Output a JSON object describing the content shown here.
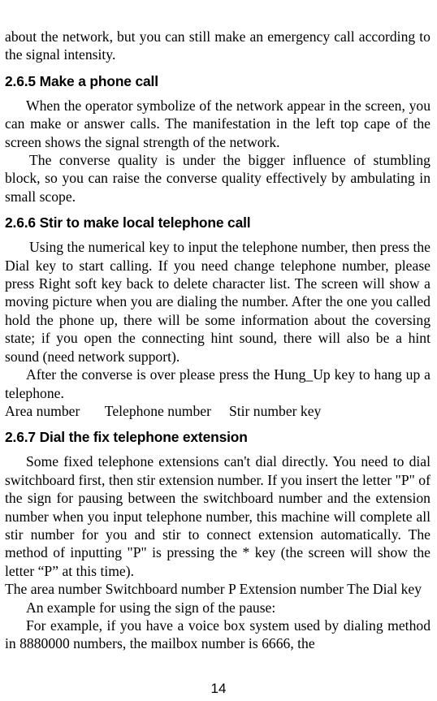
{
  "document": {
    "page_number": "14",
    "blocks": [
      {
        "type": "paragraph",
        "name": "paragraph-network-emergency-call",
        "text": "about the network, but you can still make an emergency call according to the signal intensity."
      },
      {
        "type": "heading",
        "name": "heading-2-6-5",
        "text": "2.6.5 Make a phone call"
      },
      {
        "type": "paragraph",
        "name": "paragraph-operator-symbolize",
        "text": "When the operator symbolize of the network appear in the screen, you can make or answer calls. The manifestation in the left top cape of the screen shows the signal strength of the network."
      },
      {
        "type": "paragraph",
        "name": "paragraph-converse-quality",
        "text": "The converse quality is under the bigger influence of stumbling block, so you can raise the converse quality effectively by ambulating in small scope."
      },
      {
        "type": "heading",
        "name": "heading-2-6-6",
        "text": "2.6.6 Stir to make local telephone call"
      },
      {
        "type": "paragraph",
        "name": "paragraph-using-numerical-key",
        "text": "Using the numerical key to input the telephone number, then press the Dial key to start calling. If you need change telephone number, please press Right soft key back to delete character list. The screen will show a moving picture when you are dialing the number. After the one you called hold the phone up, there will be some information about the coversing state; if you open the connecting hint sound, there will also be a hint sound (need network support)."
      },
      {
        "type": "paragraph",
        "name": "paragraph-after-converse-hangup",
        "text": "After the converse is over please press the Hung_Up key to hang up a telephone."
      },
      {
        "type": "tabline",
        "name": "tabline-area-telephone-stir",
        "text": "Area number       Telephone number     Stir number key"
      },
      {
        "type": "heading",
        "name": "heading-2-6-7",
        "text": "2.6.7 Dial the fix telephone extension"
      },
      {
        "type": "paragraph",
        "name": "paragraph-fixed-extensions",
        "text": "Some fixed telephone extensions can't dial directly. You need to dial switchboard first, then stir extension number. If you insert the letter \"P\" of the sign for pausing between the switchboard number and the extension number when you input telephone number, this machine will complete all stir number for you and stir to connect extension automatically. The method of inputting \"P\" is pressing the * key (the screen will show the letter “P” at this time)."
      },
      {
        "type": "tabline-justified",
        "name": "tabline-area-switchboard-extension",
        "text": "The area number    Switchboard number    P    Extension number        The Dial key"
      },
      {
        "type": "paragraph",
        "name": "paragraph-example-pause-sign",
        "text": "An example for using the sign of the pause:"
      },
      {
        "type": "paragraph",
        "name": "paragraph-voice-box-example",
        "text": "For example, if you have a voice box system used by dialing method in 8880000 numbers, the mailbox number is 6666, the"
      }
    ]
  }
}
